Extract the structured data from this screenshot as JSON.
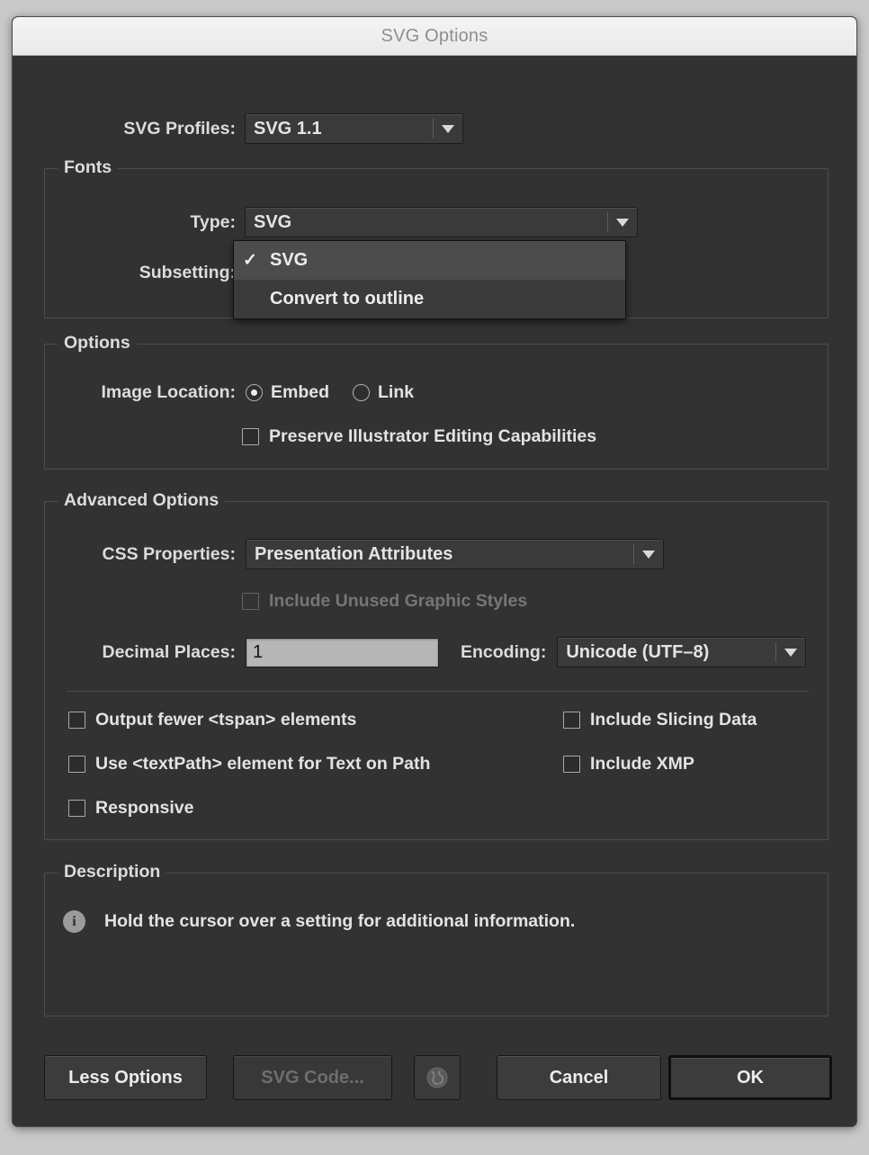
{
  "window": {
    "title": "SVG Options"
  },
  "profiles": {
    "label": "SVG Profiles:",
    "value": "SVG 1.1"
  },
  "fonts": {
    "group_title": "Fonts",
    "type_label": "Type:",
    "type_value": "SVG",
    "subsetting_label": "Subsetting:",
    "menu": {
      "items": [
        {
          "label": "SVG",
          "checked": true
        },
        {
          "label": "Convert to outline",
          "checked": false
        }
      ],
      "check_glyph": "✓"
    }
  },
  "options": {
    "group_title": "Options",
    "image_location_label": "Image Location:",
    "radios": [
      {
        "label": "Embed",
        "selected": true
      },
      {
        "label": "Link",
        "selected": false
      }
    ],
    "preserve_checkbox": {
      "label": "Preserve Illustrator Editing Capabilities",
      "checked": false
    }
  },
  "advanced": {
    "group_title": "Advanced Options",
    "css_label": "CSS Properties:",
    "css_value": "Presentation Attributes",
    "include_unused_label": "Include Unused Graphic Styles",
    "decimal_label": "Decimal Places:",
    "decimal_value": "1",
    "encoding_label": "Encoding:",
    "encoding_value": "Unicode (UTF–8)",
    "checkboxes_left": [
      {
        "label": "Output fewer <tspan> elements",
        "checked": false
      },
      {
        "label": "Use <textPath> element for Text on Path",
        "checked": false
      },
      {
        "label": "Responsive",
        "checked": false
      }
    ],
    "checkboxes_right": [
      {
        "label": "Include Slicing Data",
        "checked": false
      },
      {
        "label": "Include XMP",
        "checked": false
      }
    ]
  },
  "description": {
    "group_title": "Description",
    "icon": "info-icon",
    "text": "Hold the cursor over a setting for additional information."
  },
  "footer": {
    "less_options": "Less Options",
    "svg_code": "SVG Code...",
    "globe_icon": "globe-icon",
    "cancel": "Cancel",
    "ok": "OK"
  },
  "colors": {
    "dialog_bg": "#323232",
    "titlebar_bg": "#efefef",
    "text": "#dcdcdc",
    "field_bg": "#3a3a3a",
    "input_bg": "#b6b6b6"
  }
}
